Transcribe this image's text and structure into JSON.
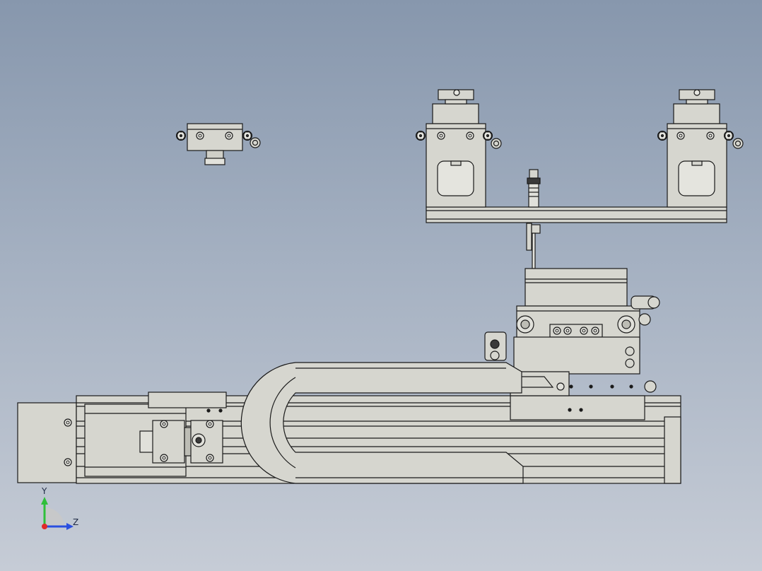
{
  "viewport": {
    "background_top": "#8797ad",
    "background_bottom": "#c6ccd6",
    "part_fill": "#d6d6cf",
    "part_fill_dark": "#bdbdb5",
    "edge_color": "#1a1a1a"
  },
  "triad": {
    "y_label": "Y",
    "z_label": "Z",
    "y_axis_color": "#2fbf3a",
    "z_axis_color": "#2a4fe0",
    "x_axis_color": "#e02a2a"
  }
}
